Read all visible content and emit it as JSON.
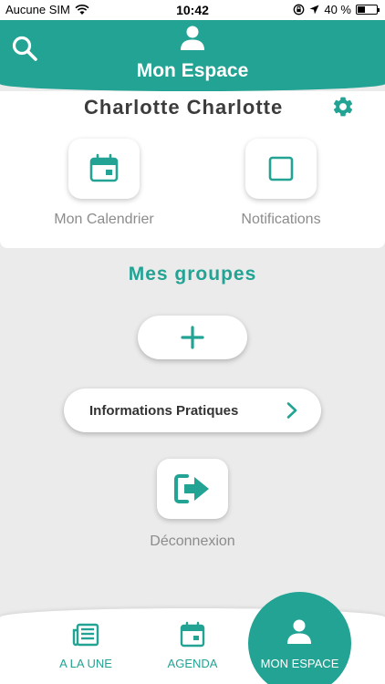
{
  "status_bar": {
    "carrier": "Aucune SIM",
    "time": "10:42",
    "battery": "40 %",
    "battery_level": 0.4
  },
  "header": {
    "title": "Mon Espace",
    "search_icon": "search-icon",
    "user_icon": "user-icon"
  },
  "profile": {
    "name": "Charlotte Charlotte",
    "settings_icon": "gear-icon"
  },
  "shortcuts": {
    "calendar_label": "Mon Calendrier",
    "notifications_label": "Notifications"
  },
  "groups": {
    "title": "Mes groupes",
    "add_icon": "plus-icon"
  },
  "info": {
    "label": "Informations Pratiques"
  },
  "logout": {
    "label": "Déconnexion"
  },
  "tabbar": {
    "items": [
      {
        "label": "A LA UNE",
        "icon": "newspaper-icon"
      },
      {
        "label": "AGENDA",
        "icon": "calendar-icon"
      },
      {
        "label": "MON ESPACE",
        "icon": "user-icon",
        "active": true
      }
    ]
  },
  "colors": {
    "accent": "#22a394",
    "background": "#ebebeb",
    "muted_text": "#8c8c8c"
  }
}
